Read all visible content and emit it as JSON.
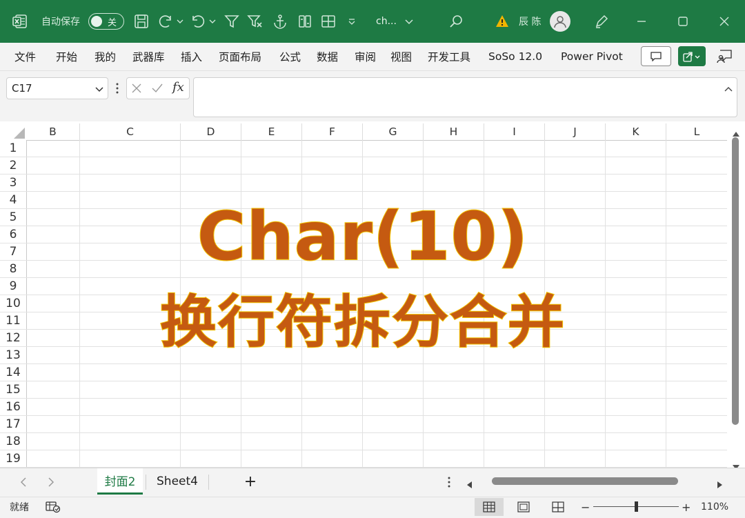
{
  "titlebar": {
    "autosave_label": "自动保存",
    "autosave_state": "关",
    "doc_name": "ch...",
    "user_name": "辰 陈",
    "bg_color": "#1e7a44"
  },
  "ribbon": {
    "tabs": [
      "文件",
      "开始",
      "我的",
      "武器库",
      "插入",
      "页面布局",
      "公式",
      "数据",
      "审阅",
      "视图",
      "开发工具",
      "SoSo 12.0",
      "Power Pivot"
    ]
  },
  "formula_bar": {
    "name_box": "C17",
    "fx_label": "fx",
    "formula": ""
  },
  "grid": {
    "columns": [
      "B",
      "C",
      "D",
      "E",
      "F",
      "G",
      "H",
      "I",
      "J",
      "K",
      "L"
    ],
    "rows": [
      "1",
      "2",
      "3",
      "4",
      "5",
      "6",
      "7",
      "8",
      "9",
      "10",
      "11",
      "12",
      "13",
      "14",
      "15",
      "16",
      "17",
      "18",
      "19"
    ]
  },
  "overlay": {
    "line1": "Char(10)",
    "line2": "换行符拆分合并",
    "fill_color": "#c55a11",
    "stroke_color": "#f2c200"
  },
  "sheets": {
    "tabs": [
      "封面2",
      "Sheet4"
    ],
    "active": "封面2",
    "add_label": "+"
  },
  "statusbar": {
    "ready": "就绪",
    "zoom_minus": "−",
    "zoom_plus": "+",
    "zoom": "110%"
  }
}
